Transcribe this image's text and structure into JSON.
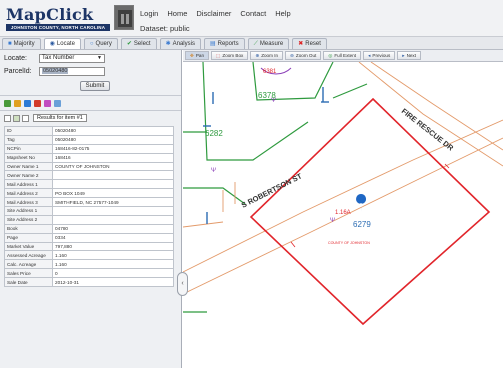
{
  "header": {
    "logo_title": "MapClick",
    "logo_subtitle": "JOHNSTON COUNTY, NORTH CAROLINA",
    "nav": [
      "Login",
      "Home",
      "Disclaimer",
      "Contact",
      "Help"
    ],
    "dataset": "Dataset: public"
  },
  "tabs": [
    {
      "label": "Majority",
      "icon": "layers-icon"
    },
    {
      "label": "Locate",
      "icon": "locate-icon",
      "active": true
    },
    {
      "label": "Query",
      "icon": "query-icon"
    },
    {
      "label": "Select",
      "icon": "select-icon"
    },
    {
      "label": "Analysis",
      "icon": "analysis-icon"
    },
    {
      "label": "Reports",
      "icon": "reports-icon"
    },
    {
      "label": "Measure",
      "icon": "measure-icon"
    },
    {
      "label": "Reset",
      "icon": "reset-icon"
    }
  ],
  "locate": {
    "locate_label": "Locate:",
    "locate_value": "Tax Number",
    "parcel_label": "ParcelId:",
    "parcel_value": "05020480",
    "submit": "Submit"
  },
  "results": {
    "label": "Results for item #1"
  },
  "attributes": [
    {
      "k": "ID",
      "v": "05020480"
    },
    {
      "k": "Tag",
      "v": "05020480"
    },
    {
      "k": "NCPin",
      "v": "168416-82-0175"
    },
    {
      "k": "Mapsheet No",
      "v": "168416"
    },
    {
      "k": "Owner Name 1",
      "v": "COUNTY OF JOHNSTON"
    },
    {
      "k": "Owner Name 2",
      "v": ""
    },
    {
      "k": "Mail Address 1",
      "v": ""
    },
    {
      "k": "Mail Address 2",
      "v": "PO BOX 1049"
    },
    {
      "k": "Mail Address 3",
      "v": "SMITHFIELD, NC 27577-1049"
    },
    {
      "k": "Site Address 1",
      "v": ""
    },
    {
      "k": "Site Address 2",
      "v": ""
    },
    {
      "k": "Book",
      "v": "04780"
    },
    {
      "k": "Page",
      "v": "0334"
    },
    {
      "k": "Market Value",
      "v": "797,880"
    },
    {
      "k": "Assessed Acreage",
      "v": "1.160"
    },
    {
      "k": "Calc. Acreage",
      "v": "1.160"
    },
    {
      "k": "Sales Price",
      "v": "0"
    },
    {
      "k": "Sale Date",
      "v": "2012-10-31"
    }
  ],
  "map_toolbar": [
    {
      "label": "Pan",
      "icon": "pan-icon",
      "pressed": true
    },
    {
      "label": "Zoom Box",
      "icon": "zoom-box-icon"
    },
    {
      "label": "Zoom In",
      "icon": "zoom-in-icon"
    },
    {
      "label": "Zoom Out",
      "icon": "zoom-out-icon"
    },
    {
      "label": "Full Extent",
      "icon": "full-extent-icon"
    },
    {
      "label": "Previous",
      "icon": "previous-icon"
    },
    {
      "label": "Next",
      "icon": "next-icon"
    }
  ],
  "map": {
    "street_1": "S ROBERTSON ST",
    "street_2": "FIRE RESCUE DR",
    "parcel_labels": [
      "6282",
      "6378",
      "6279",
      "6381"
    ],
    "owner_label": "COUNTY OF JOHNSTON",
    "colors": {
      "selected_parcel": "#e1252b",
      "parcel_line": "#2e9a3e",
      "road_edge": "#e39a6a",
      "label_green": "#2e9a3e",
      "label_blue": "#2b6cb3",
      "marker": "#1f67c4",
      "purple": "#8b3fb8"
    }
  },
  "collapse_icon": "‹"
}
